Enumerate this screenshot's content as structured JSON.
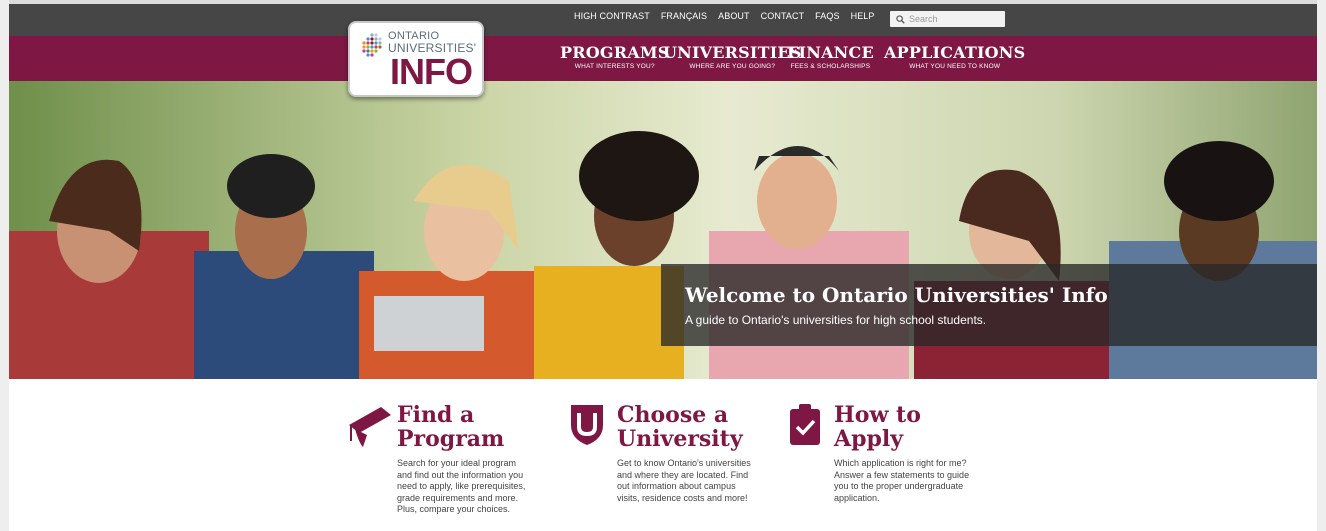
{
  "utility": {
    "links": [
      "HIGH CONTRAST",
      "FRANÇAIS",
      "ABOUT",
      "CONTACT",
      "FAQS",
      "HELP"
    ],
    "search_placeholder": "Search"
  },
  "logo": {
    "line1": "ONTARIO",
    "line2": "UNIVERSITIES'",
    "line3": "INFO"
  },
  "nav": [
    {
      "title": "PROGRAMS",
      "subtitle": "WHAT INTERESTS YOU?"
    },
    {
      "title": "UNIVERSITIES",
      "subtitle": "WHERE ARE YOU GOING?"
    },
    {
      "title": "FINANCE",
      "subtitle": "FEES & SCHOLARSHIPS"
    },
    {
      "title": "APPLICATIONS",
      "subtitle": "WHAT YOU NEED TO KNOW"
    }
  ],
  "hero": {
    "title": "Welcome to Ontario Universities' Info",
    "subtitle": "A guide to Ontario's universities for high school students."
  },
  "features": [
    {
      "title1": "Find a",
      "title2": "Program",
      "desc": [
        "Search for your ideal program",
        "and find out the information you",
        "need to apply, like prerequisites,",
        "grade requirements and more.",
        "Plus, compare your choices."
      ],
      "icon": "graduation-cap-icon"
    },
    {
      "title1": "Choose a",
      "title2": "University",
      "desc": [
        "Get to know Ontario's universities",
        "and where they are located. Find",
        "out information about campus",
        "visits, residence costs and more!"
      ],
      "icon": "university-shield-icon"
    },
    {
      "title1": "How to",
      "title2": "Apply",
      "desc": [
        "Which application is right for me?",
        "Answer a few statements to guide",
        "you to the proper undergraduate",
        "application."
      ],
      "icon": "clipboard-check-icon"
    }
  ],
  "colors": {
    "brand": "#7e1744",
    "utility_bar": "#464646"
  }
}
